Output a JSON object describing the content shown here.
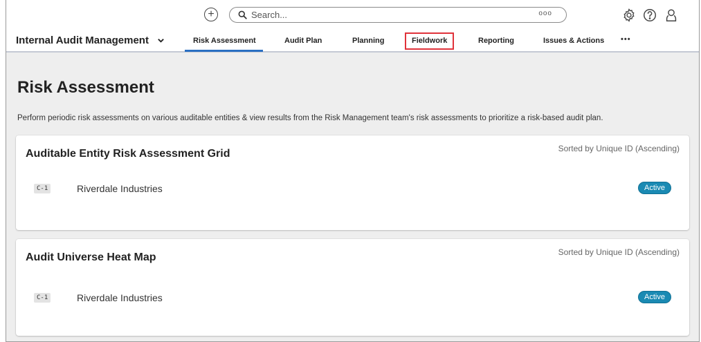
{
  "topbar": {
    "search_placeholder": "Search...",
    "search_more": "ooo",
    "icons": [
      "plus-circle-icon",
      "search-icon",
      "settings-icon",
      "help-icon",
      "user-icon"
    ]
  },
  "nav": {
    "app_name": "Internal Audit Management",
    "tabs": [
      {
        "label": "Risk Assessment",
        "active": true
      },
      {
        "label": "Audit Plan"
      },
      {
        "label": "Planning"
      },
      {
        "label": "Fieldwork",
        "highlighted": true
      },
      {
        "label": "Reporting"
      },
      {
        "label": "Issues & Actions"
      }
    ],
    "overflow": "•••"
  },
  "page": {
    "title": "Risk Assessment",
    "description": "Perform periodic risk assessments on various auditable entities & view results from the Risk Management team's risk assessments to prioritize a risk-based audit plan."
  },
  "cards": [
    {
      "title": "Auditable Entity Risk Assessment Grid",
      "sort": "Sorted by Unique ID (Ascending)",
      "rows": [
        {
          "id": "C-1",
          "name": "Riverdale Industries",
          "status": "Active"
        }
      ]
    },
    {
      "title": "Audit Universe Heat Map",
      "sort": "Sorted by Unique ID (Ascending)",
      "rows": [
        {
          "id": "C-1",
          "name": "Riverdale Industries",
          "status": "Active"
        }
      ]
    }
  ],
  "colors": {
    "accent": "#2a6fc2",
    "highlight": "#e0323a",
    "status_active": "#1a8ab3",
    "background": "#eeeeee"
  }
}
